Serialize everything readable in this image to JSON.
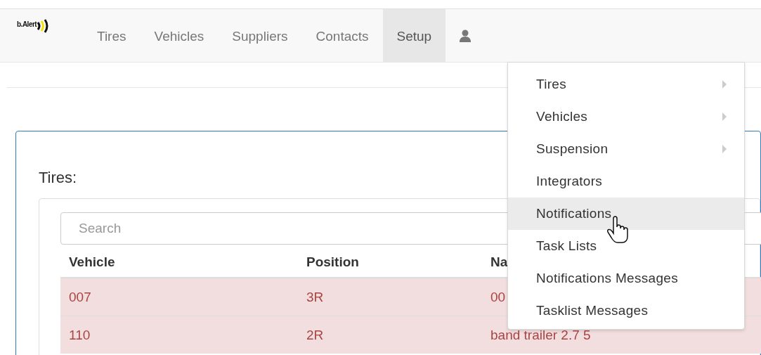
{
  "navbar": {
    "brand": "b.Alert",
    "items": [
      {
        "label": "Tires",
        "selected": false
      },
      {
        "label": "Vehicles",
        "selected": false
      },
      {
        "label": "Suppliers",
        "selected": false
      },
      {
        "label": "Contacts",
        "selected": false
      },
      {
        "label": "Setup",
        "selected": true
      }
    ]
  },
  "setup_menu": {
    "items": [
      {
        "label": "Tires",
        "submenu": true,
        "highlighted": false
      },
      {
        "label": "Vehicles",
        "submenu": true,
        "highlighted": false
      },
      {
        "label": "Suspension",
        "submenu": true,
        "highlighted": false
      },
      {
        "label": "Integrators",
        "submenu": false,
        "highlighted": false
      },
      {
        "label": "Notifications",
        "submenu": false,
        "highlighted": true
      },
      {
        "label": "Task Lists",
        "submenu": false,
        "highlighted": false
      },
      {
        "label": "Notifications Messages",
        "submenu": false,
        "highlighted": false
      },
      {
        "label": "Tasklist Messages",
        "submenu": false,
        "highlighted": false
      }
    ]
  },
  "panel": {
    "title": "Tires:",
    "search": {
      "placeholder": "Search"
    },
    "table": {
      "columns": [
        "Vehicle",
        "Position",
        "Na"
      ],
      "rows": [
        {
          "cells": [
            "007",
            "3R",
            "00"
          ],
          "error": true
        },
        {
          "cells": [
            "110",
            "2R",
            "band trailer 2.7 5"
          ],
          "error": true
        }
      ]
    }
  }
}
